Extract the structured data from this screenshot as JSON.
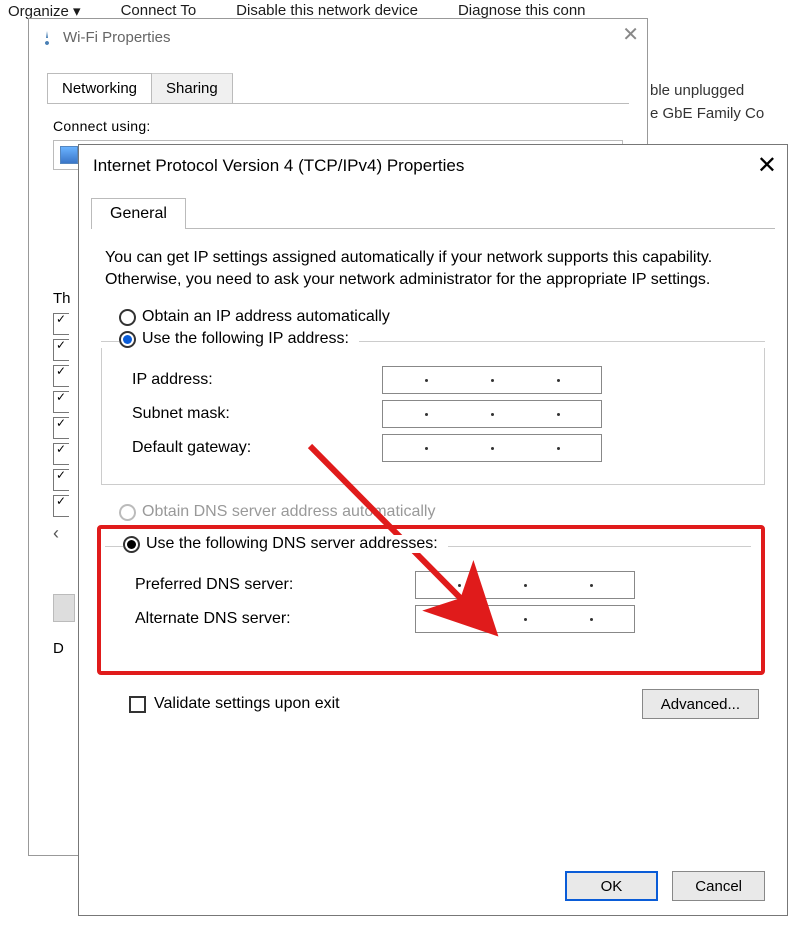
{
  "bg": {
    "organize": "Organize ▾",
    "connect": "Connect To",
    "disable": "Disable this network device",
    "diagnose": "Diagnose this conn",
    "side1": "ble unplugged",
    "side2": "e GbE Family Co"
  },
  "wifi": {
    "title": "Wi-Fi Properties",
    "tabs": {
      "networking": "Networking",
      "sharing": "Sharing"
    },
    "connect_using": "Connect using:",
    "this_label": "Th",
    "desc_label": "D",
    "arrow_left": "‹"
  },
  "ipv4": {
    "title": "Internet Protocol Version 4 (TCP/IPv4) Properties",
    "tab_general": "General",
    "intro": "You can get IP settings assigned automatically if your network supports this capability. Otherwise, you need to ask your network administrator for the appropriate IP settings.",
    "radio_obtain_ip": "Obtain an IP address automatically",
    "radio_use_ip": "Use the following IP address:",
    "ip_address": "IP address:",
    "subnet_mask": "Subnet mask:",
    "default_gateway": "Default gateway:",
    "radio_obtain_dns": "Obtain DNS server address automatically",
    "radio_use_dns": "Use the following DNS server addresses:",
    "preferred_dns": "Preferred DNS server:",
    "alternate_dns": "Alternate DNS server:",
    "validate": "Validate settings upon exit",
    "advanced": "Advanced...",
    "ok": "OK",
    "cancel": "Cancel"
  }
}
